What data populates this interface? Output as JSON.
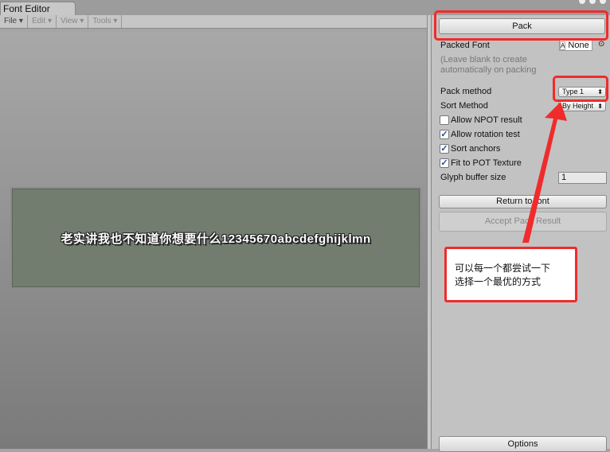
{
  "window": {
    "tab_title": "Font Editor"
  },
  "menubar": [
    {
      "label": "File",
      "enabled": true
    },
    {
      "label": "Edit",
      "enabled": false
    },
    {
      "label": "View",
      "enabled": false
    },
    {
      "label": "Tools",
      "enabled": false
    }
  ],
  "preview": {
    "text": "老实讲我也不知道你想要什么12345670abcdefghijklmn"
  },
  "panel": {
    "pack_label": "Pack",
    "packed_font_label": "Packed Font",
    "packed_font_value": "None",
    "hint": "(Leave blank to create automatically on packing",
    "pack_method_label": "Pack method",
    "pack_method_value": "Type 1",
    "sort_method_label": "Sort Method",
    "sort_method_value": "By Height",
    "checkboxes": [
      {
        "label": "Allow NPOT result",
        "checked": false
      },
      {
        "label": "Allow rotation test",
        "checked": true
      },
      {
        "label": "Sort anchors",
        "checked": true
      },
      {
        "label": "Fit to POT Texture",
        "checked": true
      }
    ],
    "glyph_buffer_label": "Glyph buffer size",
    "glyph_buffer_value": "1",
    "return_label": "Return to font",
    "accept_label": "Accept Pack Result",
    "options_label": "Options"
  },
  "annotation": {
    "line1": "可以每一个都尝试一下",
    "line2": "选择一个最优的方式",
    "color": "#f02b2b"
  }
}
